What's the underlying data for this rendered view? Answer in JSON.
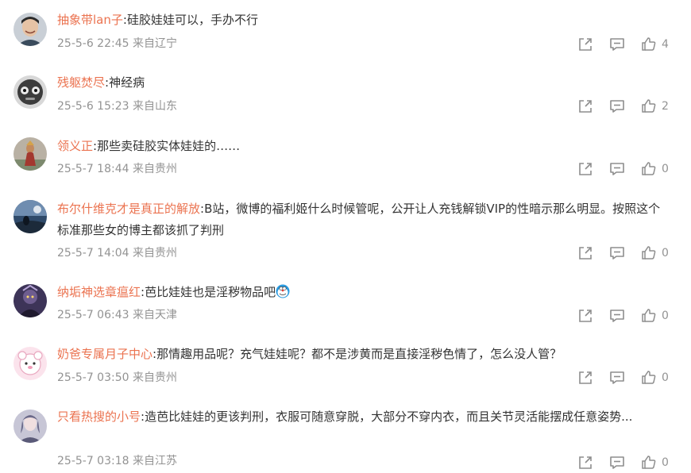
{
  "comments": [
    {
      "user": "抽象带lan子",
      "text": "硅胶娃娃可以，手办不行",
      "date": "25-5-6 22:45",
      "location": "来自辽宁",
      "likes": "4"
    },
    {
      "user": "残躯焚尽",
      "text": "神经病",
      "date": "25-5-6 15:23",
      "location": "来自山东",
      "likes": "2"
    },
    {
      "user": "领义正",
      "text": "那些卖硅胶实体娃娃的……",
      "date": "25-5-7 18:44",
      "location": "来自贵州",
      "likes": "0"
    },
    {
      "user": "布尔什维克才是真正的解放",
      "text": "B站，微博的福利姬什么时候管呢，公开让人充钱解锁VIP的性暗示那么明显。按照这个标准那些女的博主都该抓了判刑",
      "date": "25-5-7 14:04",
      "location": "来自贵州",
      "likes": "0"
    },
    {
      "user": "纳垢神选章瘟红",
      "text": "芭比娃娃也是淫秽物品吧",
      "date": "25-5-7 06:43",
      "location": "来自天津",
      "likes": "0",
      "emoji": "doraemon-emoji"
    },
    {
      "user": "奶爸专属月子中心",
      "text": "那情趣用品呢？充气娃娃呢？都不是涉黄而是直接淫秽色情了，怎么没人管？",
      "date": "25-5-7 03:50",
      "location": "来自贵州",
      "likes": "0"
    },
    {
      "user": "只看热搜的小号",
      "text": "造芭比娃娃的更该判刑，衣服可随意穿脱，大部分不穿内衣，而且关节灵活能摆成任意姿势...",
      "date": "25-5-7 03:18",
      "location": "来自江苏",
      "likes": "0"
    }
  ],
  "colors": {
    "username": "#eb7350",
    "meta": "#939393",
    "text": "#333333"
  },
  "icons": {
    "share": "share-icon",
    "reply": "comment-icon",
    "like": "thumbs-up-icon"
  }
}
